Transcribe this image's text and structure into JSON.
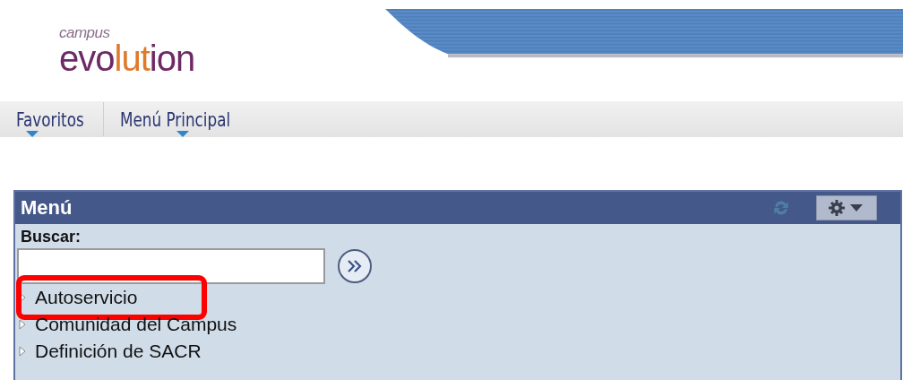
{
  "logo": {
    "tagline": "campus",
    "wordmark": [
      {
        "text": "evo",
        "color": "#6e2a66"
      },
      {
        "text": "lut",
        "color": "#e0792c"
      },
      {
        "text": "ion",
        "color": "#6e2a66"
      }
    ]
  },
  "nav": [
    {
      "label": "Favoritos"
    },
    {
      "label": "Menú Principal"
    }
  ],
  "menu": {
    "title": "Menú",
    "search_label": "Buscar:",
    "items": [
      {
        "label": "Autoservicio",
        "highlighted": true
      },
      {
        "label": "Comunidad del Campus",
        "highlighted": false
      },
      {
        "label": "Definición de SACR",
        "highlighted": false
      }
    ]
  }
}
